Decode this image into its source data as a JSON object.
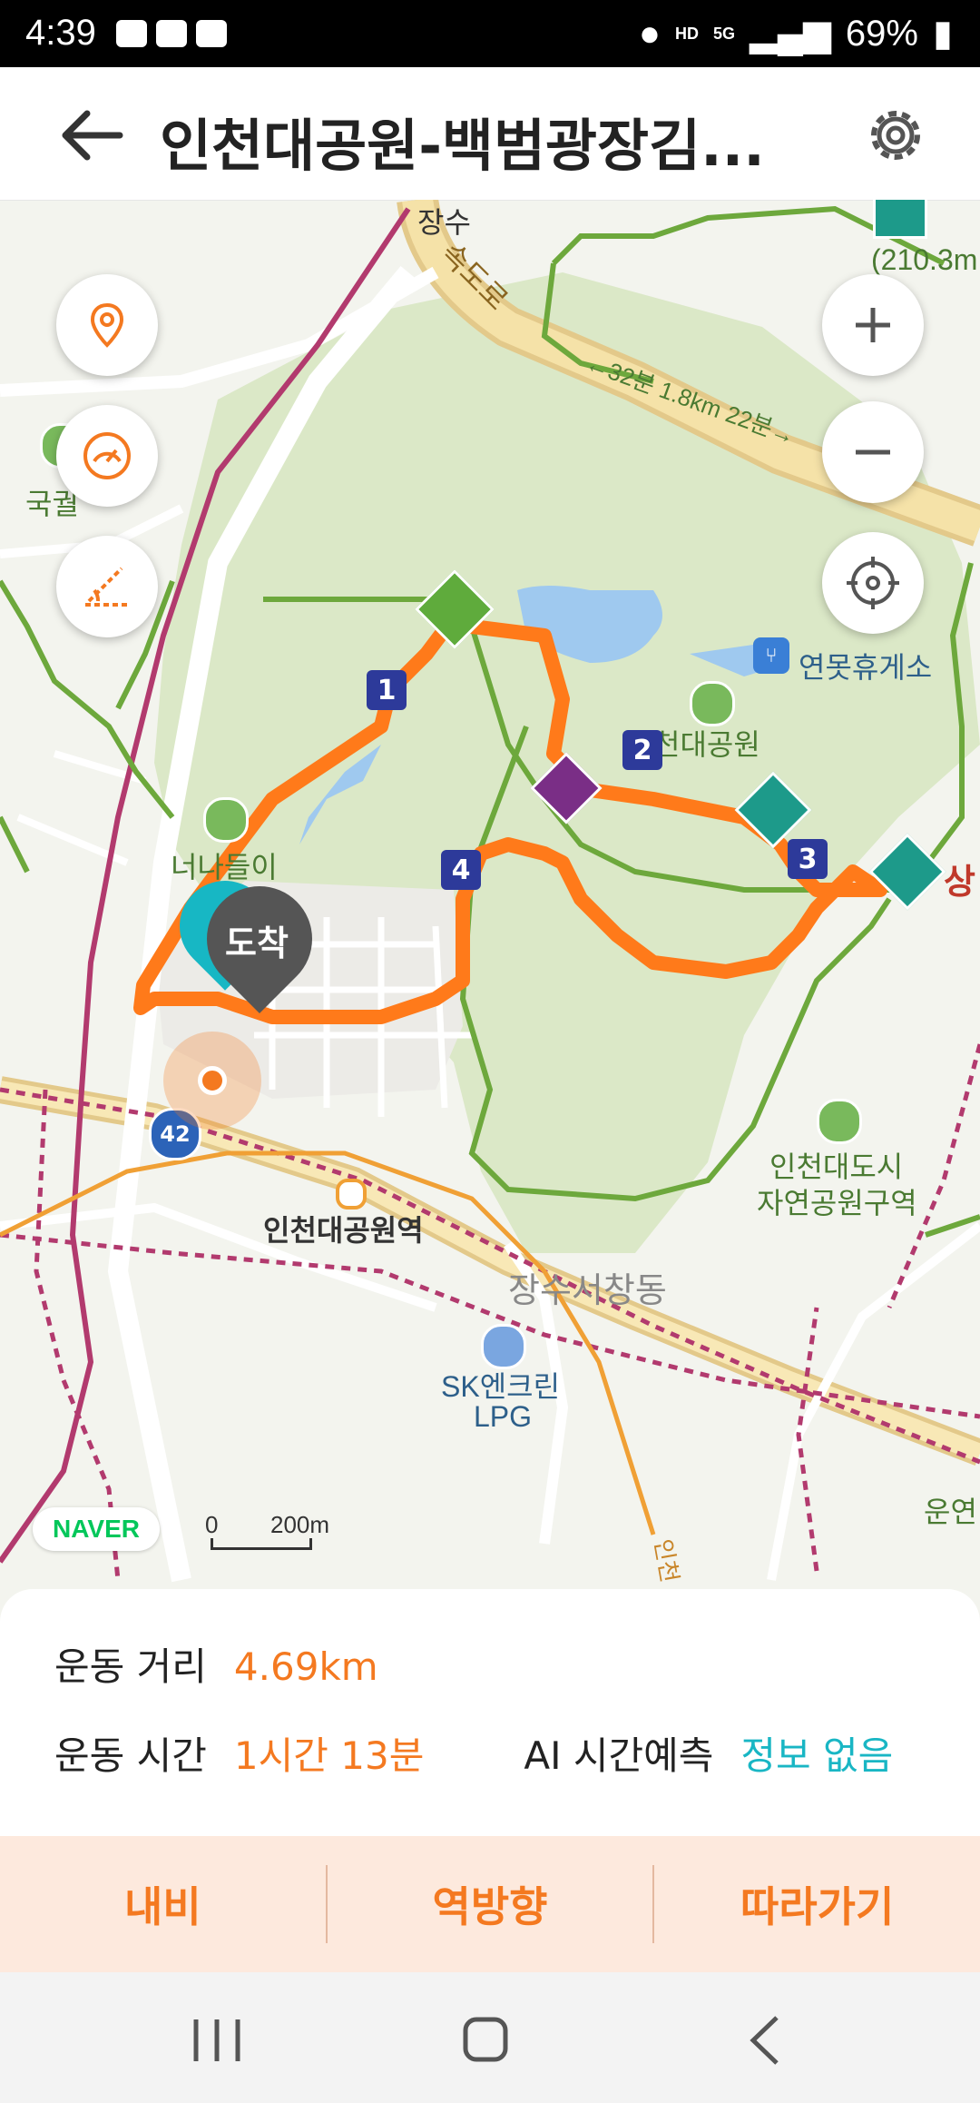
{
  "status_bar": {
    "time": "4:39",
    "hd": "HD",
    "network": "5G",
    "battery": "69%"
  },
  "header": {
    "title": "인천대공원-백범광장김...",
    "back_icon": "arrow-left-icon",
    "settings_icon": "gear-icon"
  },
  "map": {
    "labels": {
      "jangsu_ic": "장수",
      "expressway": "속도로",
      "mountain_top": "(210.3m",
      "distance_note": "←32분 1.8km 22분→",
      "rest_area": "연못휴게소",
      "park": "천대공원",
      "neomeo": "너나들이",
      "gukgul": "국궐",
      "sang": "상",
      "arrive": "도착",
      "station": "인천대공원역",
      "dong": "장수서창동",
      "gas_line1": "SK엔크린",
      "gas_line2": "LPG",
      "nature_line1": "인천대도시",
      "nature_line2": "자연공원구역",
      "unyeon": "운연",
      "road_num": "42",
      "line_label": "인천"
    },
    "waypoints": [
      "1",
      "2",
      "3",
      "4"
    ],
    "naver_logo": "NAVER",
    "scale_zero": "0",
    "scale_label": "200m",
    "accent_color": "#f47920",
    "route_color": "#ff7a1a"
  },
  "info": {
    "distance_label": "운동 거리",
    "distance_value": "4.69km",
    "time_label": "운동 시간",
    "time_value": "1시간 13분",
    "ai_label": "AI 시간예측",
    "ai_value": "정보 없음"
  },
  "actions": {
    "navi": "내비",
    "reverse": "역방향",
    "follow": "따라가기"
  }
}
